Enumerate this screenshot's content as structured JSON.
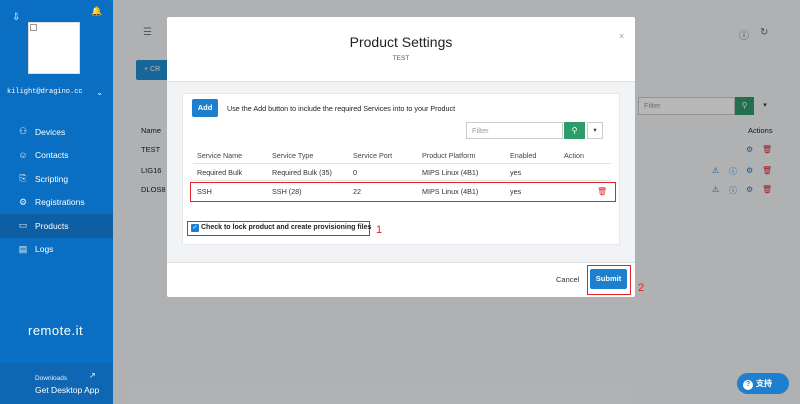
{
  "sidebar": {
    "user_email": "kilight@dragino.cc",
    "items": [
      {
        "label": "Devices",
        "icon": "devices-icon"
      },
      {
        "label": "Contacts",
        "icon": "contacts-icon"
      },
      {
        "label": "Scripting",
        "icon": "scripting-icon"
      },
      {
        "label": "Registrations",
        "icon": "registrations-icon"
      },
      {
        "label": "Products",
        "icon": "products-icon",
        "active": true
      },
      {
        "label": "Logs",
        "icon": "logs-icon"
      }
    ],
    "logo_text": "remote.it",
    "downloads_small": "Downloads",
    "downloads_big": "Get Desktop App"
  },
  "background": {
    "create_label": "CR",
    "filter_placeholder": "Filter",
    "col_name": "Name",
    "col_actions": "Actions",
    "rows": [
      "TEST",
      "LIG16",
      "DLOS8"
    ]
  },
  "modal": {
    "title": "Product Settings",
    "subtitle": "TEST",
    "add_label": "Add",
    "add_hint": "Use the Add button to include the required Services into to your Product",
    "filter_placeholder": "Filter",
    "columns": [
      "Service Name",
      "Service Type",
      "Service Port",
      "Product Platform",
      "Enabled",
      "Action"
    ],
    "rows": [
      [
        "Required Bulk",
        "Required Bulk (35)",
        "0",
        "MIPS Linux (4B1)",
        "yes"
      ],
      [
        "SSH",
        "SSH (28)",
        "22",
        "MIPS Linux (4B1)",
        "yes"
      ]
    ],
    "lock_label": "Check to lock product and create provisioning files",
    "cancel_label": "Cancel",
    "submit_label": "Submit"
  },
  "annotations": {
    "one": "1",
    "two": "2"
  },
  "support_label": "支持",
  "colors": {
    "sidebar": "#0a6fc2",
    "primary": "#1f7fcf",
    "success": "#2e9b6b",
    "annotation": "#e0242b"
  }
}
